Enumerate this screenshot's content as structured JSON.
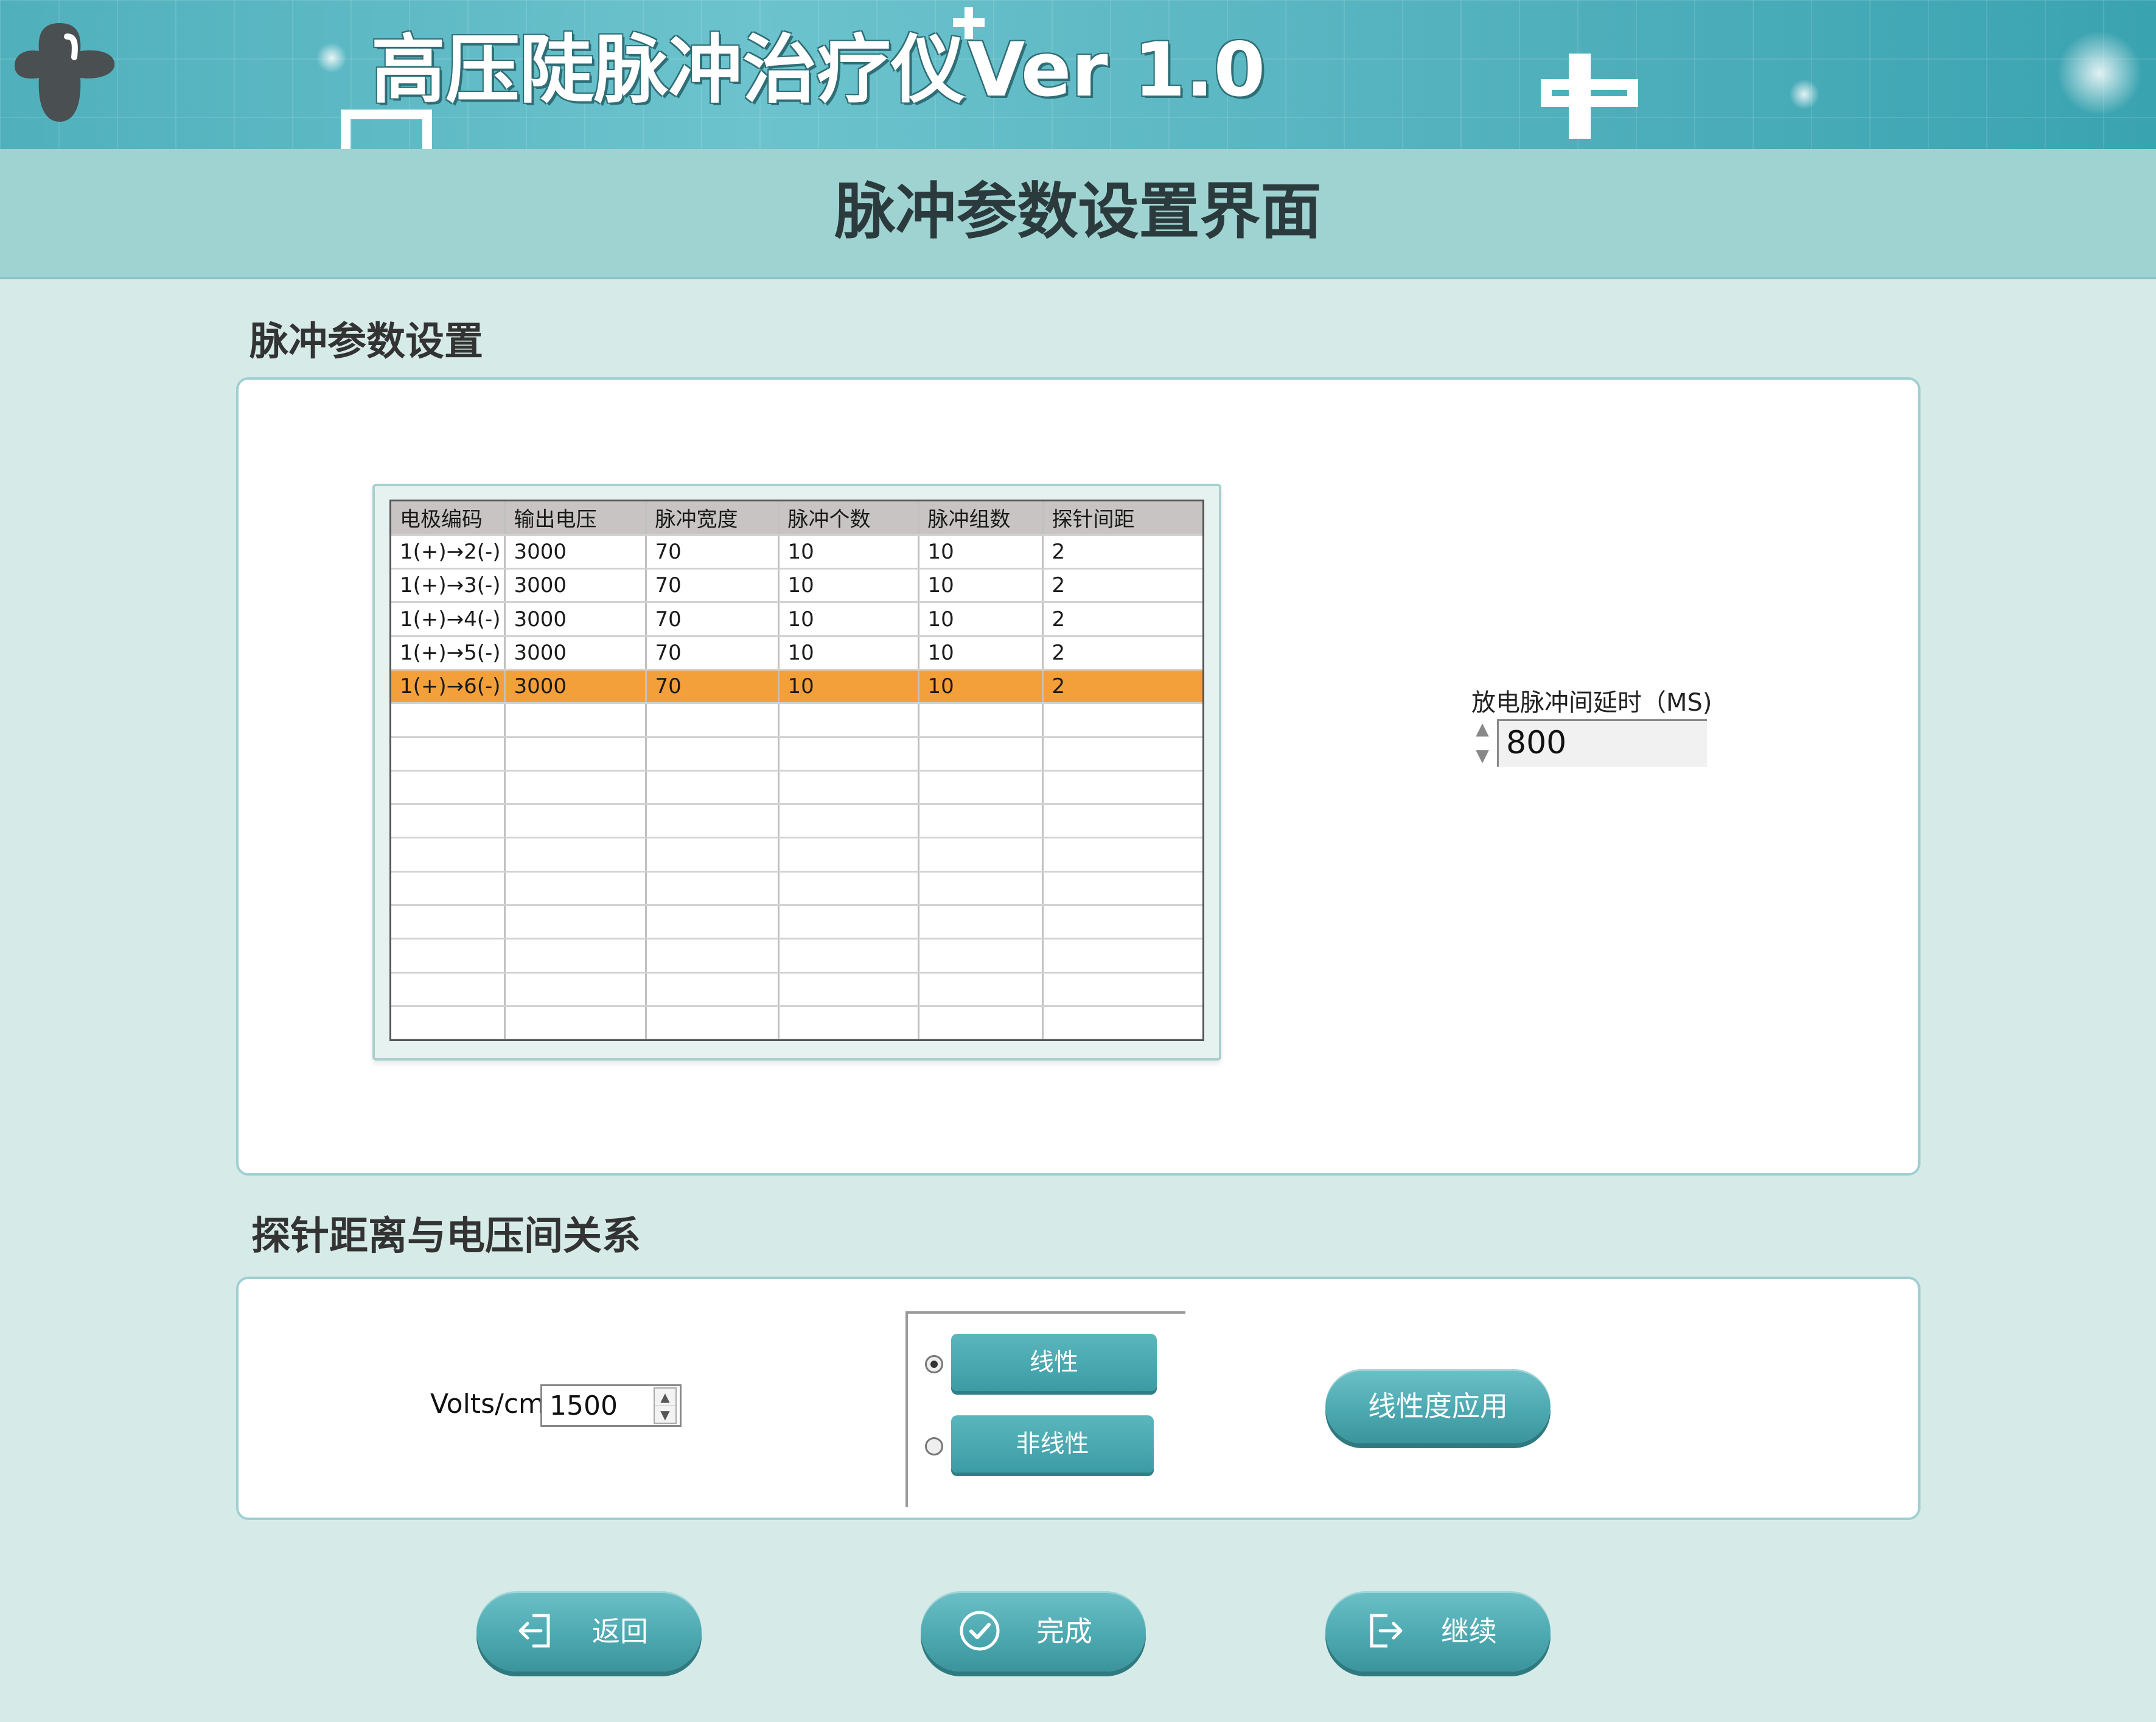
{
  "header": {
    "app_title": "高压陡脉冲治疗仪",
    "version": "Ver 1.0",
    "page_title": "脉冲参数设置界面"
  },
  "pulse_section": {
    "label": "脉冲参数设置",
    "table": {
      "columns": [
        "电极编码",
        "输出电压",
        "脉冲宽度",
        "脉冲个数",
        "脉冲组数",
        "探针间距"
      ],
      "rows": [
        [
          "1(+)→2(-)",
          "3000",
          "70",
          "10",
          "10",
          "2"
        ],
        [
          "1(+)→3(-)",
          "3000",
          "70",
          "10",
          "10",
          "2"
        ],
        [
          "1(+)→4(-)",
          "3000",
          "70",
          "10",
          "10",
          "2"
        ],
        [
          "1(+)→5(-)",
          "3000",
          "70",
          "10",
          "10",
          "2"
        ],
        [
          "1(+)→6(-)",
          "3000",
          "70",
          "10",
          "10",
          "2"
        ]
      ],
      "selected_row": 4,
      "selected_color": "#f4a03a"
    },
    "delay": {
      "label": "放电脉冲间延时（MS)",
      "value": "800"
    }
  },
  "relation_section": {
    "label": "探针距离与电压间关系",
    "volts_label": "Volts/cm:",
    "volts_value": "1500",
    "options": [
      {
        "label": "线性",
        "selected": true
      },
      {
        "label": "非线性",
        "selected": false
      }
    ],
    "apply_button": "线性度应用"
  },
  "footer": {
    "back_button": "返回",
    "done_button": "完成",
    "continue_button": "继续"
  },
  "colors": {
    "accent": "#4da9b1",
    "banner": "#55b3bf",
    "background": "#d6ebe7"
  }
}
